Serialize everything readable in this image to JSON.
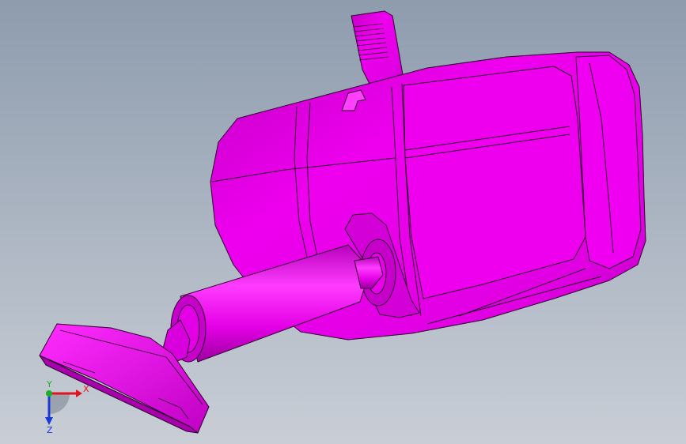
{
  "viewport": {
    "background_top": "#8e9cae",
    "background_bottom": "#c9ced6",
    "model_color": "#e600e6",
    "model_shadow": "#a300a8",
    "edge_color": "#2a002a"
  },
  "triad": {
    "x_label": "X",
    "y_label": "Y",
    "z_label": "Z",
    "x_color": "#e0141e",
    "y_color": "#18b02a",
    "z_color": "#1a3ad8"
  }
}
